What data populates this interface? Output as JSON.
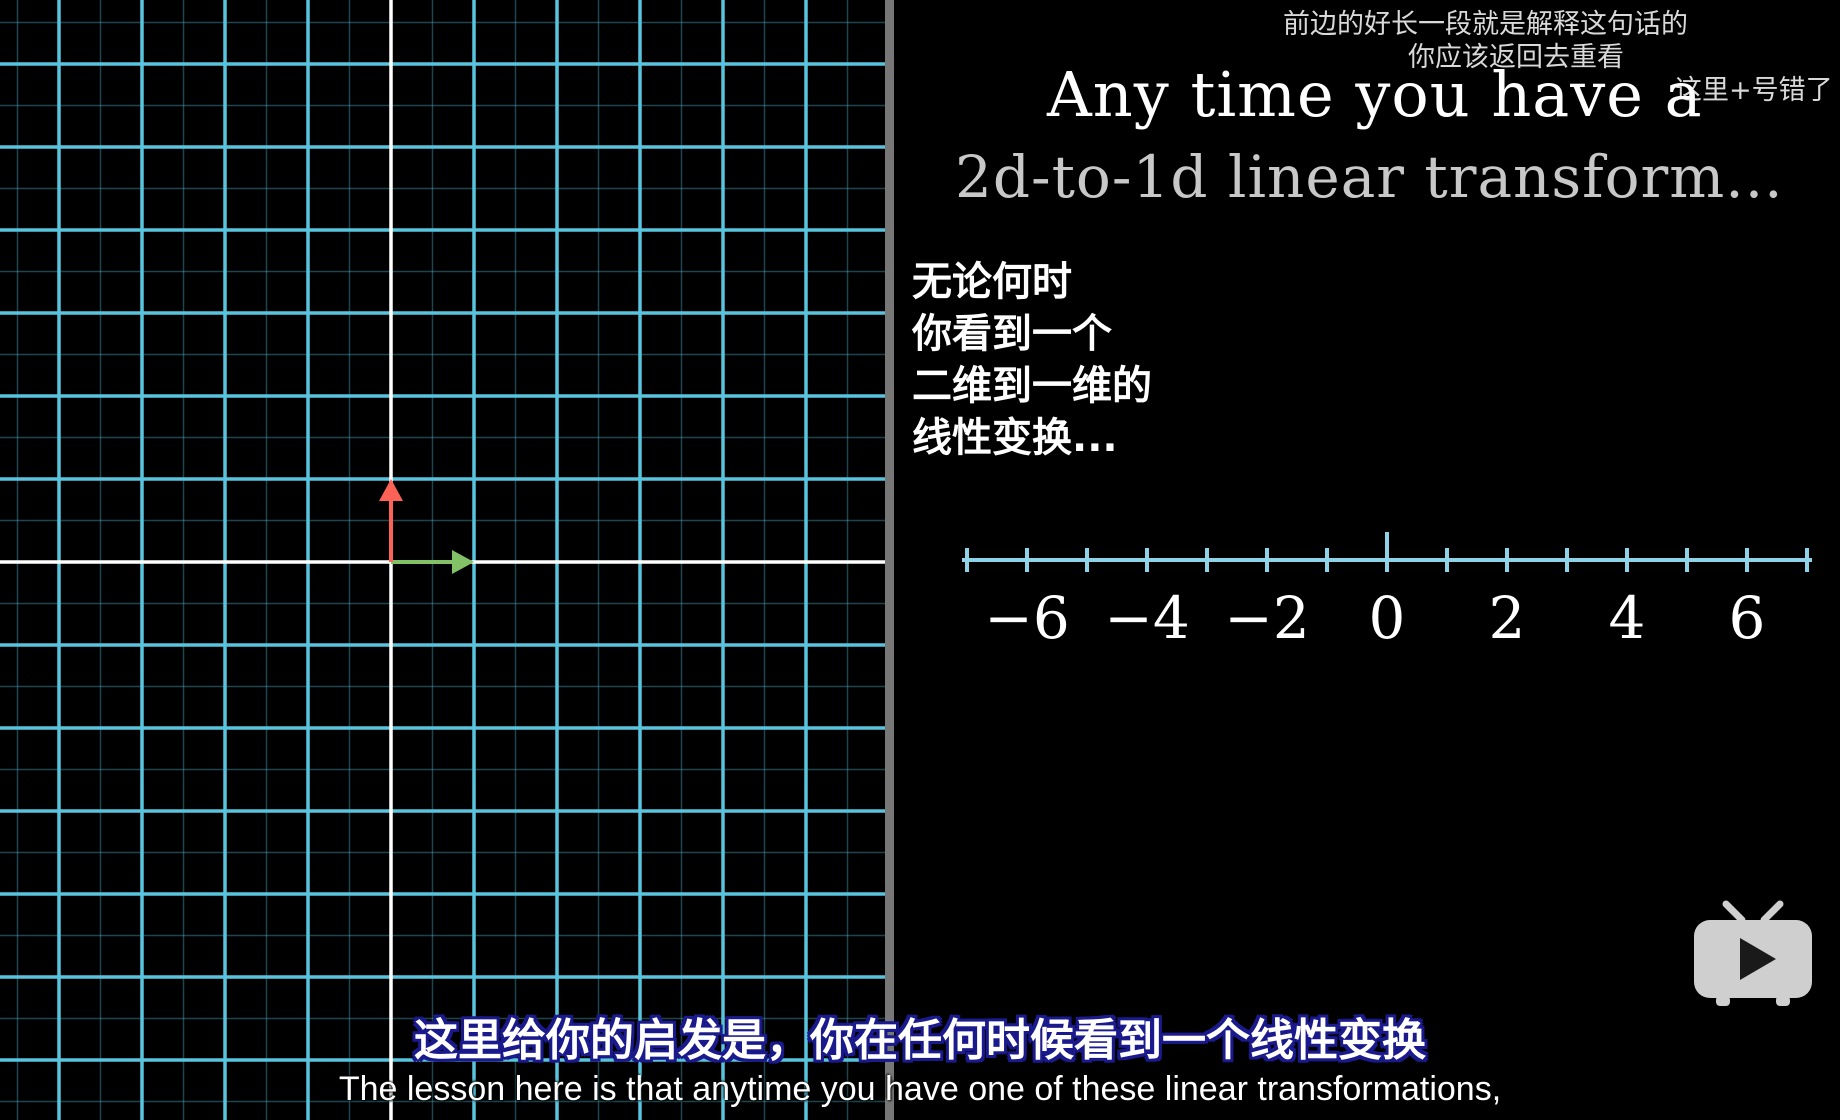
{
  "danmaku": {
    "line1": "前边的好长一段就是解释这句话的",
    "line2": "你应该返回去重看",
    "line3": "这里+号错了"
  },
  "title": {
    "line1": "Any time you have a",
    "line2": "2d-to-1d linear transform..."
  },
  "zh_caption": {
    "lines": [
      "无论何时",
      "你看到一个",
      "二维到一维的",
      "线性变换..."
    ]
  },
  "number_line": {
    "labels": [
      "−6",
      "−4",
      "−2",
      "0",
      "2",
      "4",
      "6"
    ],
    "min": -7,
    "max": 7,
    "color": "#8fd3e8"
  },
  "subtitles": {
    "zh": "这里给你的启发是，你在任何时候看到一个线性变换",
    "en": "The lesson here is that anytime you have one of these linear transformations,"
  },
  "colors": {
    "grid": "#58c4dd",
    "axis": "#ffffff",
    "i_hat": "#83c167",
    "j_hat": "#fc6255"
  },
  "icons": {
    "player_logo": "bilibili-tv-play-icon"
  }
}
